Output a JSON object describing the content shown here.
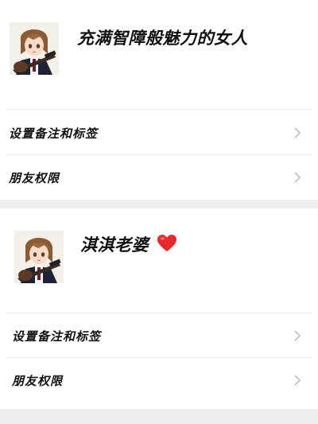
{
  "contacts": [
    {
      "name": "充满智障般魅力的女人",
      "has_heart": false,
      "rows": [
        {
          "label": "设置备注和标签"
        },
        {
          "label": "朋友权限"
        }
      ]
    },
    {
      "name": "淇淇老婆",
      "has_heart": true,
      "rows": [
        {
          "label": "设置备注和标签"
        },
        {
          "label": "朋友权限"
        }
      ]
    }
  ],
  "colors": {
    "background": "#ffffff",
    "separator_band": "#eeeeee",
    "divider": "#ececec",
    "chevron": "#b2b2b2",
    "heart": "#e8282b"
  },
  "icons": [
    "avatar-anime-girl-guitar",
    "chevron-right-icon",
    "heart-icon"
  ]
}
